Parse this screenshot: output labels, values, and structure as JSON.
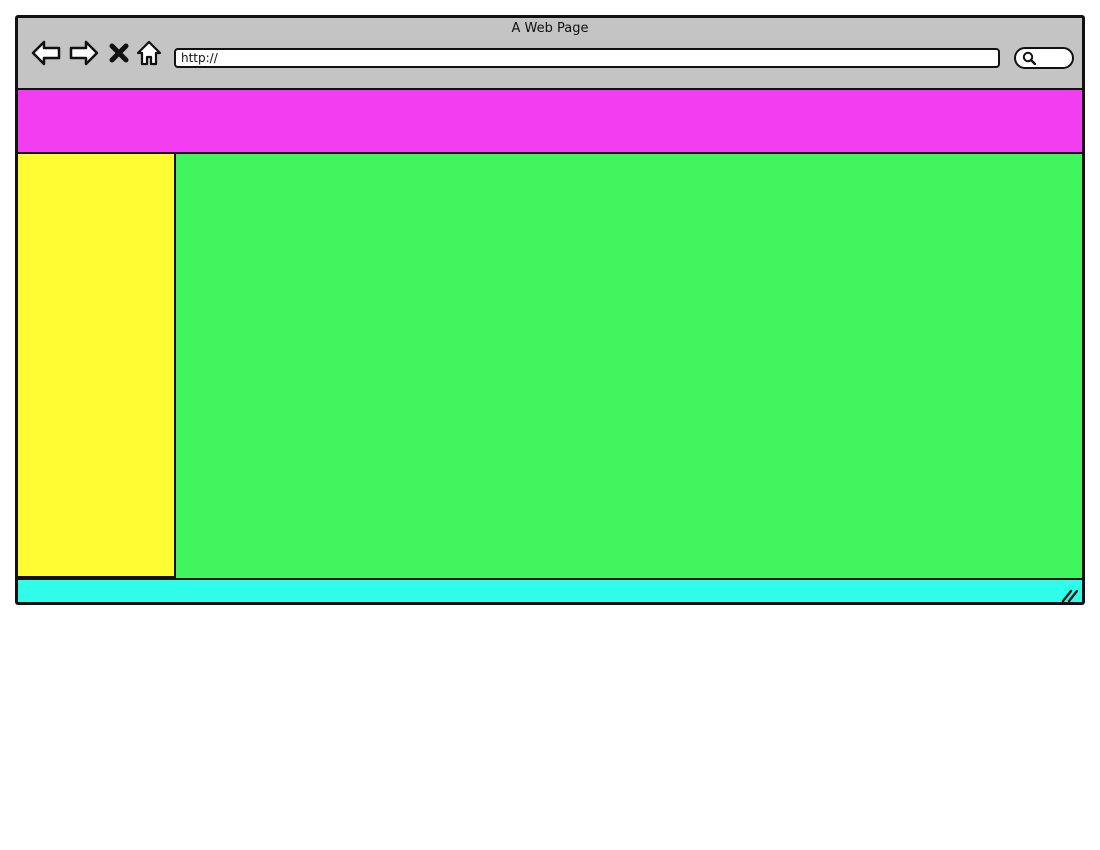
{
  "window": {
    "title": "A Web Page"
  },
  "toolbar": {
    "back_icon": "back-arrow-icon",
    "forward_icon": "forward-arrow-icon",
    "stop_icon": "close-icon",
    "home_icon": "home-icon",
    "address_value": "http://",
    "search_icon": "search-icon"
  },
  "colors": {
    "chrome": "#c4c4c4",
    "header_banner": "#f23df0",
    "sidebar": "#fffc33",
    "main_content": "#40f55d",
    "status_bar": "#2ffde9",
    "outline": "#111111"
  },
  "status_bar": {
    "resize_icon": "resize-grip-icon"
  }
}
